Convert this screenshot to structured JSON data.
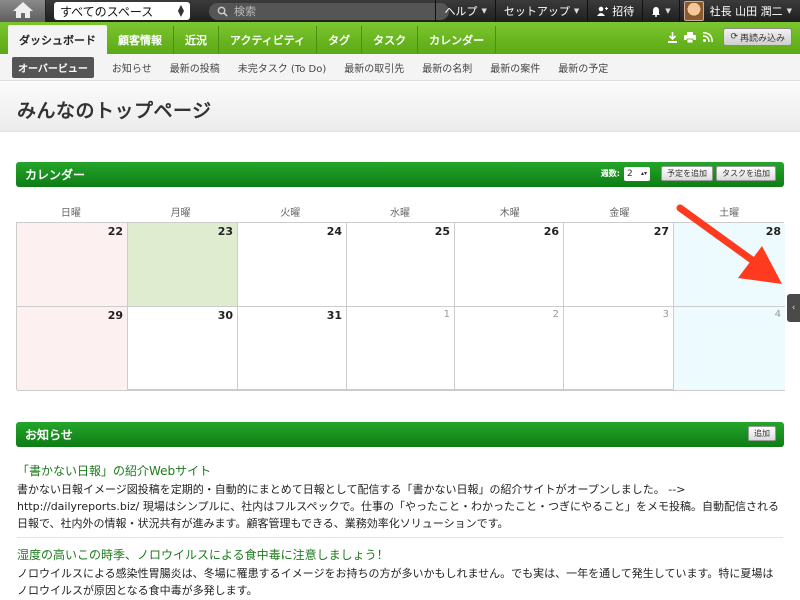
{
  "topbar": {
    "space_select": "すべてのスペース",
    "search_placeholder": "検索",
    "menu": [
      "ヘルプ",
      "セットアップ",
      "招待"
    ],
    "user_name": "社長 山田 潤二"
  },
  "tabs": [
    "ダッシュボード",
    "顧客情報",
    "近況",
    "アクティビティ",
    "タグ",
    "タスク",
    "カレンダー"
  ],
  "tab_tools": {
    "reload_label": "再読み込み"
  },
  "subnav": [
    "オーバービュー",
    "お知らせ",
    "最新の投稿",
    "未完タスク (To Do)",
    "最新の取引先",
    "最新の名刺",
    "最新の案件",
    "最新の予定"
  ],
  "page_title": "みんなのトップページ",
  "calendar": {
    "title": "カレンダー",
    "weeks_label": "週数:",
    "weeks_value": "2",
    "add_event_label": "予定を追加",
    "add_task_label": "タスクを追加",
    "weekdays": [
      "日曜",
      "月曜",
      "火曜",
      "水曜",
      "木曜",
      "金曜",
      "土曜"
    ],
    "days": [
      "22",
      "23",
      "24",
      "25",
      "26",
      "27",
      "28",
      "29",
      "30",
      "31",
      "1",
      "2",
      "3",
      "4"
    ]
  },
  "news": {
    "title": "お知らせ",
    "add_label": "追加",
    "items": [
      {
        "title": "「書かない日報」の紹介Webサイト",
        "body": "書かない日報イメージ図投稿を定期的・自動的にまとめて日報として配信する「書かない日報」の紹介サイトがオープンしました。 --> http://dailyreports.biz/ 現場はシンプルに、社内はフルスペックで。仕事の「やったこと・わかったこと・つぎにやること」をメモ投稿。自動配信される日報で、社内外の情報・状況共有が進みます。顧客管理もできる、業務効率化ソリューションです。"
      },
      {
        "title": "湿度の高いこの時季、ノロウイルスによる食中毒に注意しましょう！",
        "body": "ノロウイルスによる感染性胃腸炎は、冬場に罹患するイメージをお持ちの方が多いかもしれません。でも実は、一年を通して発生しています。特に夏場はノロウイルスが原因となる食中毒が多発します。"
      }
    ]
  },
  "colors": {
    "brand_green": "#5aa916",
    "header_green": "#1a9020",
    "arrow_red": "#ff3b1f"
  }
}
